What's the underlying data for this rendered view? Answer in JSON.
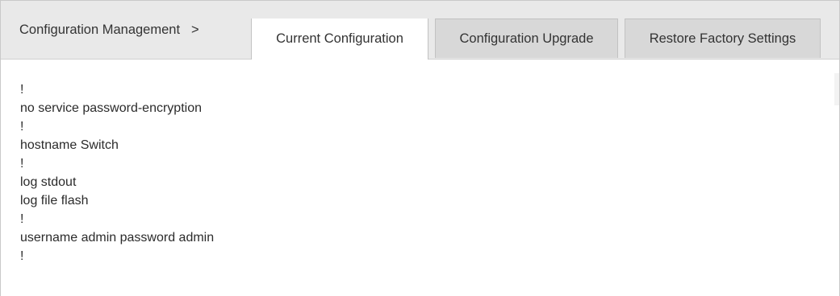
{
  "breadcrumb": {
    "label": "Configuration Management",
    "separator": ">"
  },
  "tabs": [
    {
      "label": "Current Configuration",
      "active": true
    },
    {
      "label": "Configuration Upgrade",
      "active": false
    },
    {
      "label": "Restore Factory Settings",
      "active": false
    }
  ],
  "config_lines": [
    "!",
    "no service password-encryption",
    "!",
    "hostname Switch",
    "!",
    "log stdout",
    "log file flash",
    "!",
    "username admin password admin",
    "!"
  ]
}
